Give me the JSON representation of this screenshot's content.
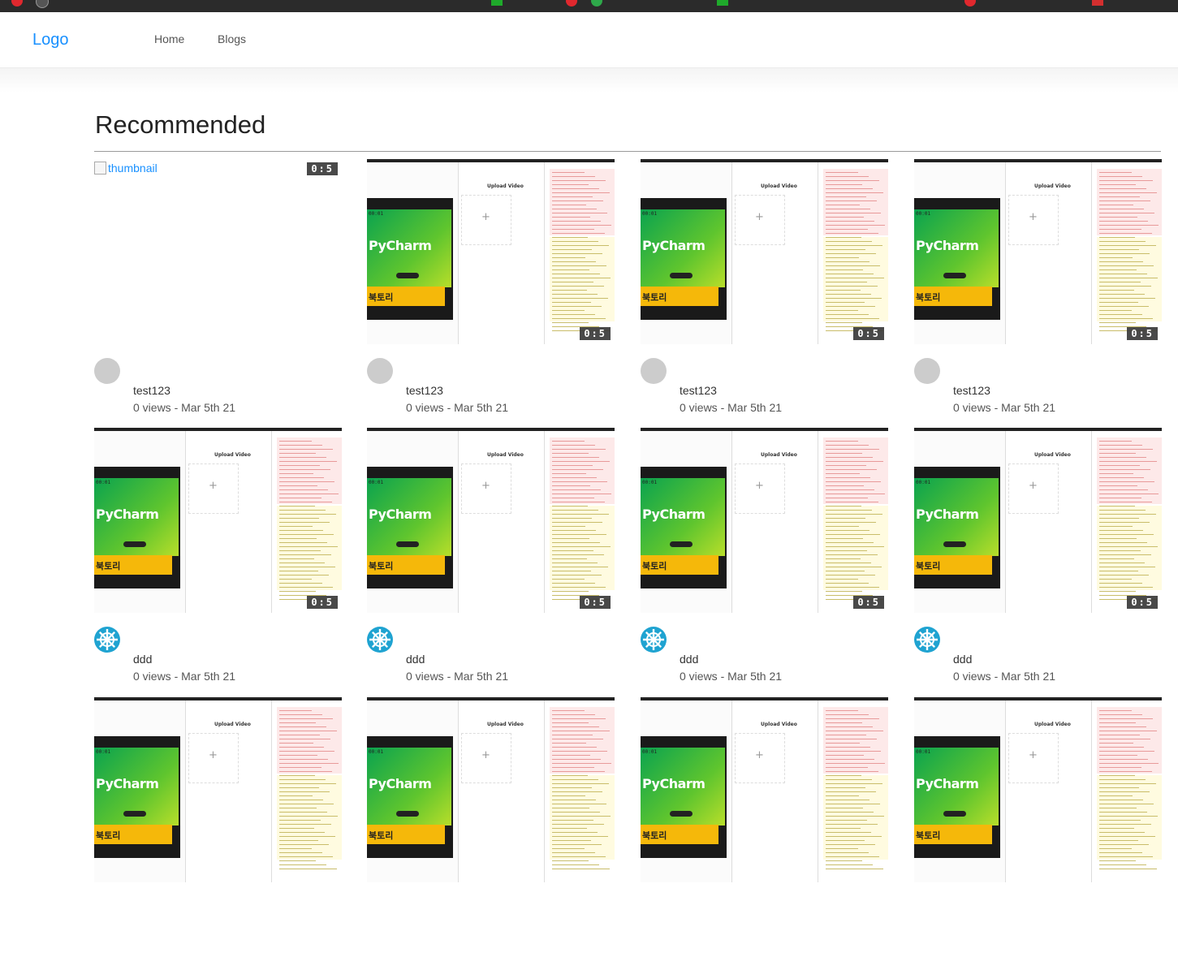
{
  "nav": {
    "logo": "Logo",
    "links": [
      {
        "label": "Home"
      },
      {
        "label": "Blogs"
      }
    ]
  },
  "section": {
    "title": "Recommended"
  },
  "thumbnail_alt": "thumbnail",
  "video_thumbnail_text": {
    "upload_title": "Upload Video",
    "plus": "+",
    "pycharm": "PyCharm",
    "banner": "북토리",
    "timecode": "00:01"
  },
  "videos": [
    {
      "author": "test123",
      "meta": "0 views - Mar 5th 21",
      "duration": "0:5",
      "avatar": "gray",
      "thumbnail": "broken"
    },
    {
      "author": "test123",
      "meta": "0 views - Mar 5th 21",
      "duration": "0:5",
      "avatar": "gray",
      "thumbnail": "screenshot"
    },
    {
      "author": "test123",
      "meta": "0 views - Mar 5th 21",
      "duration": "0:5",
      "avatar": "gray",
      "thumbnail": "screenshot"
    },
    {
      "author": "test123",
      "meta": "0 views - Mar 5th 21",
      "duration": "0:5",
      "avatar": "gray",
      "thumbnail": "screenshot"
    },
    {
      "author": "ddd",
      "meta": "0 views - Mar 5th 21",
      "duration": "0:5",
      "avatar": "snowflake",
      "thumbnail": "screenshot"
    },
    {
      "author": "ddd",
      "meta": "0 views - Mar 5th 21",
      "duration": "0:5",
      "avatar": "snowflake",
      "thumbnail": "screenshot"
    },
    {
      "author": "ddd",
      "meta": "0 views - Mar 5th 21",
      "duration": "0:5",
      "avatar": "snowflake",
      "thumbnail": "screenshot"
    },
    {
      "author": "ddd",
      "meta": "0 views - Mar 5th 21",
      "duration": "0:5",
      "avatar": "snowflake",
      "thumbnail": "screenshot"
    },
    {
      "thumbnail": "screenshot"
    },
    {
      "thumbnail": "screenshot"
    },
    {
      "thumbnail": "screenshot"
    },
    {
      "thumbnail": "screenshot"
    }
  ],
  "colors": {
    "accent": "#1890ff",
    "avatar_gray": "#cccccc",
    "snowflake_avatar": "#1fa3d1",
    "duration_bg": "#3a3a3a"
  }
}
